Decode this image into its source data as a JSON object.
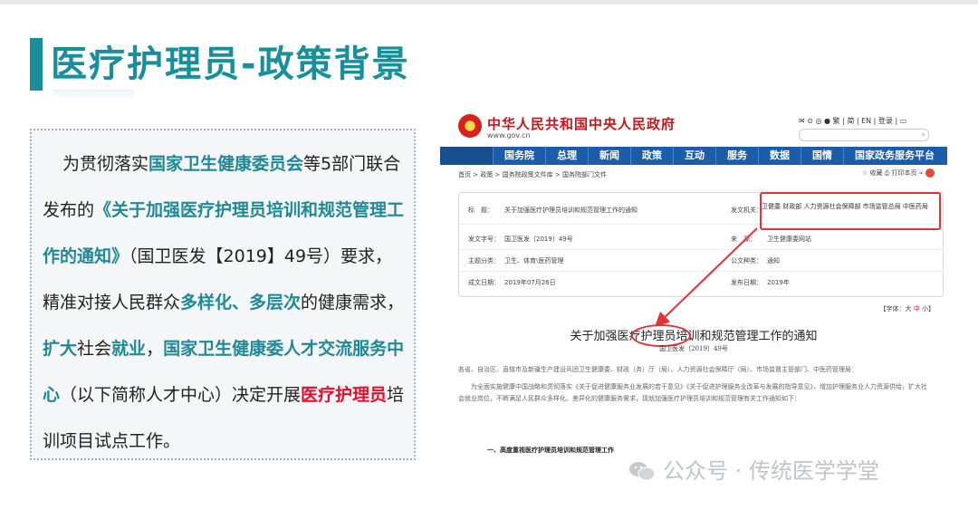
{
  "slide": {
    "title": "医疗护理员-政策背景",
    "paragraph": [
      {
        "text": "为贯彻落实",
        "style": "n"
      },
      {
        "text": "国家卫生健康委员会",
        "style": "t"
      },
      {
        "text": "等5部门联合发布的",
        "style": "n"
      },
      {
        "text": "《关于加强医疗护理员培训和规范管理工作的通知》",
        "style": "t"
      },
      {
        "text": "（国卫医发【2019】49号）要求，精准对接人民群众",
        "style": "n"
      },
      {
        "text": "多样化、多层次",
        "style": "t"
      },
      {
        "text": "的健康需求，",
        "style": "n"
      },
      {
        "text": "扩大",
        "style": "t"
      },
      {
        "text": "社会",
        "style": "n"
      },
      {
        "text": "就业",
        "style": "t"
      },
      {
        "text": "，",
        "style": "n"
      },
      {
        "text": "国家卫生健康委人才交流服务中心",
        "style": "t"
      },
      {
        "text": "（以下简称人才中心）决定开展",
        "style": "n"
      },
      {
        "text": "医疗护理员",
        "style": "r"
      },
      {
        "text": "培训项目试点工作。",
        "style": "n"
      }
    ]
  },
  "doc": {
    "site_name": "中华人民共和国中央人民政府",
    "site_url": "www.gov.cn",
    "header_links": "✉ ⊙ ◎ ● 繁 | 简 | EN | 登录 | ▭",
    "nav": [
      "国务院",
      "总理",
      "新闻",
      "政策",
      "互动",
      "服务",
      "数据",
      "国情",
      "国家政务服务平台"
    ],
    "breadcrumb": "首页 > 政策 > 国务院政策文件库 > 国务院部门文件",
    "tools": "☆ 收藏 ⎙ 打印本页 ∝",
    "meta": {
      "title_label": "标　题：",
      "title_value": "关于加强医疗护理员培训和规范管理工作的通知",
      "issuer_label": "发文机关：",
      "issuer_value": "卫健委 财政部 人力资源社会保障部 市场监管总局 中医药局",
      "docno_label": "发文字号：",
      "docno_value": "国卫医发〔2019〕49号",
      "source_label": "来　源：",
      "source_value": "卫生健康委网站",
      "topic_label": "主题分类：",
      "topic_value": "卫生、体育\\医药管理",
      "type_label": "公文种类：",
      "type_value": "通知",
      "date_label": "成文日期：",
      "date_value": "2019年07月26日",
      "pub_label": "发布日期：",
      "pub_value": "2019年"
    },
    "font_ctrl": {
      "prefix": "【字体：",
      "large": "大",
      "mid": "中",
      "small": "小",
      "suffix": "】"
    },
    "title": "关于加强医疗护理员培训和规范管理工作的通知",
    "doc_no": "国卫医发〔2019〕49号",
    "body": [
      "各省、自治区、直辖市及新疆生产建设兵团卫生健康委、财政（务）厅（局）、人力资源社会保障厅（局）、市场监督主管部门、中医药管理局：",
      "为全面实施健康中国战略和贯彻落实《关于促进健康服务业发展的若干意见》《关于促进护理服务业改革与发展的指导意见》，增加护理服务业人力资源供给，扩大社会就业岗位，不断满足人民群众多样化、差异化的健康服务需求，现就加强医疗护理员培训和规范管理有关工作通知如下："
    ],
    "section1": "一、高度重视医疗护理员培训和规范管理工作"
  },
  "watermark": "公众号 · 传统医学学堂",
  "colors": {
    "teal": "#1a8f9c",
    "red": "#e0102a",
    "nav_blue": "#1b5da8"
  }
}
